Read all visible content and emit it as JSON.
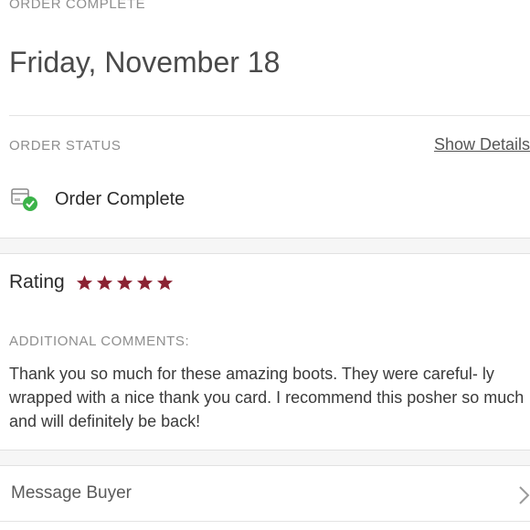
{
  "header": {
    "label": "ORDER COMPLETE",
    "date": "Friday, November 18"
  },
  "order_status": {
    "label": "ORDER STATUS",
    "show_details": "Show Details",
    "status": "Order Complete",
    "icon": "package-check-icon"
  },
  "rating": {
    "label": "Rating",
    "stars": 5,
    "max_stars": 5,
    "star_color": "#8b2232"
  },
  "comments": {
    "label": "ADDITIONAL COMMENTS:",
    "text": "Thank you so much for these amazing boots. They were careful- ly wrapped with a nice thank you card. I recommend this posher so much and will definitely be back!"
  },
  "message": {
    "label": "Message Buyer",
    "icon": "chevron-right-icon"
  },
  "colors": {
    "check_green": "#3cb34a",
    "muted_label": "#8e8e8e"
  }
}
